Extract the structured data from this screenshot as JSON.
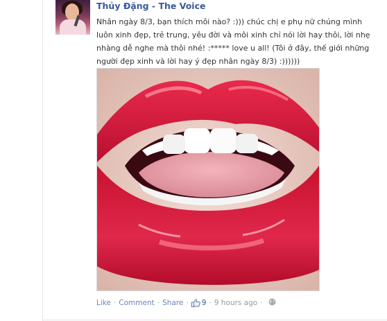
{
  "post": {
    "author": "Thủy Đặng - The Voice",
    "text": "Nhân ngày 8/3, bạn thích môi nào? :))) chúc chị e phụ nữ chúng mình luôn xinh đẹp, trẻ trung, yêu đời và môi xinh chỉ nói lời hay thôi, lời nhẹ nhàng dễ nghe mà thôi nhé! :***** love u all! (Tôi ở đây, thế giới những người đẹp xinh và lời hay ý đẹp nhân ngày 8/3) :))))))",
    "photo_alt": "",
    "actions": {
      "like": "Like",
      "comment": "Comment",
      "share": "Share",
      "like_count": "9",
      "time": "9 hours ago",
      "separator": "·"
    }
  },
  "icons": {
    "like": "thumbs-up-icon",
    "privacy": "globe-icon"
  },
  "colors": {
    "link": "#3b5998",
    "action_link": "#6d84b4",
    "muted": "#999999",
    "lip": "#d8163c"
  }
}
